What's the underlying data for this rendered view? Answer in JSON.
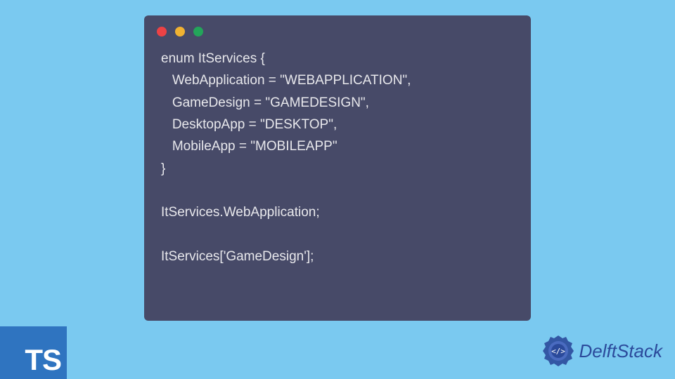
{
  "code_window": {
    "lines": [
      "enum ItServices {",
      "   WebApplication = \"WEBAPPLICATION\",",
      "   GameDesign = \"GAMEDESIGN\",",
      "   DesktopApp = \"DESKTOP\",",
      "   MobileApp = \"MOBILEAPP\"",
      "}",
      "",
      "ItServices.WebApplication;",
      "",
      "ItServices['GameDesign'];"
    ],
    "controls": {
      "close_color": "#ed4245",
      "minimize_color": "#f0b232",
      "maximize_color": "#23a55a"
    },
    "background": "#474a68",
    "text_color": "#e8e8ec"
  },
  "ts_badge": {
    "text": "TS",
    "background": "#2f74c0",
    "color": "#ffffff"
  },
  "brand": {
    "name": "DelftStack",
    "icon_color": "#2b4a9b"
  },
  "page_background": "#7ac9f0"
}
